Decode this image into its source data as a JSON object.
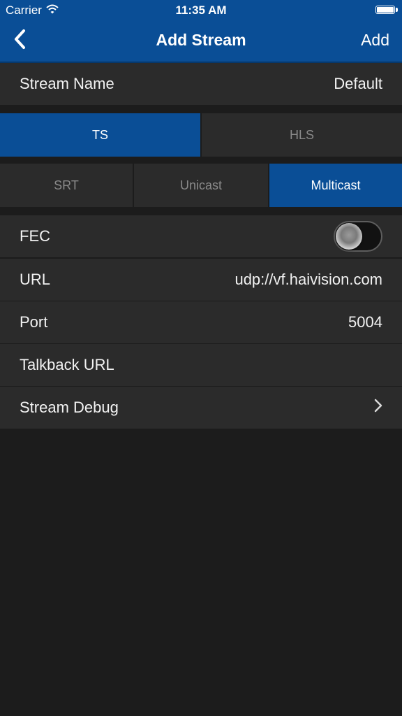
{
  "status_bar": {
    "carrier": "Carrier",
    "time": "11:35 AM"
  },
  "nav": {
    "title": "Add Stream",
    "action": "Add",
    "back_icon": "chevron-left-icon"
  },
  "stream_name": {
    "label": "Stream Name",
    "value": "Default"
  },
  "format_tabs": {
    "options": [
      "TS",
      "HLS"
    ],
    "selected": "TS"
  },
  "mode_tabs": {
    "options": [
      "SRT",
      "Unicast",
      "Multicast"
    ],
    "selected": "Multicast"
  },
  "settings": {
    "fec": {
      "label": "FEC",
      "enabled": false
    },
    "url": {
      "label": "URL",
      "value": "udp://vf.haivision.com"
    },
    "port": {
      "label": "Port",
      "value": "5004"
    },
    "talkback": {
      "label": "Talkback URL",
      "value": ""
    },
    "debug": {
      "label": "Stream Debug",
      "icon": "chevron-right-icon"
    }
  },
  "colors": {
    "accent": "#0a4e96",
    "background": "#1c1c1c",
    "cell": "#2b2b2b"
  }
}
